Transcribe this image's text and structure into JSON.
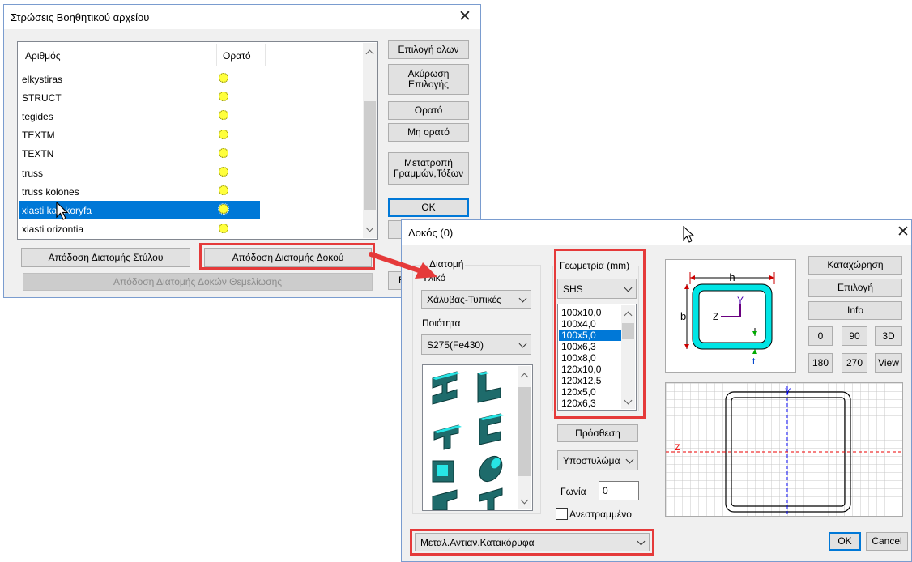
{
  "layers_dialog": {
    "title": "Στρώσεις Βοηθητικού αρχείου",
    "columns": [
      "Αριθμός",
      "Ορατό"
    ],
    "rows": [
      {
        "name": "elkystiras",
        "visible": true,
        "selected": false
      },
      {
        "name": "STRUCT",
        "visible": true,
        "selected": false
      },
      {
        "name": "tegides",
        "visible": true,
        "selected": false
      },
      {
        "name": "TEXTM",
        "visible": true,
        "selected": false
      },
      {
        "name": "TEXTN",
        "visible": true,
        "selected": false
      },
      {
        "name": "truss",
        "visible": true,
        "selected": false
      },
      {
        "name": "truss kolones",
        "visible": true,
        "selected": false
      },
      {
        "name": "xiasti katakoryfa",
        "visible": true,
        "selected": true
      },
      {
        "name": "xiasti orizontia",
        "visible": true,
        "selected": false
      }
    ],
    "buttons": {
      "select_all": "Επιλογή ολων",
      "cancel_selection": "Ακύρωση Επιλογής",
      "visible": "Ορατό",
      "not_visible": "Μη ορατό",
      "convert": "Μετατροπή Γραμμών,Τόξων",
      "ok": "OK",
      "column_section": "Απόδοση Διατομής Στύλου",
      "beam_section": "Απόδοση Διατομής Δοκού",
      "foundation_section": "Απόδοση Διατομής Δοκών Θεμελίωσης",
      "hidden_partial": "Ε"
    }
  },
  "beam_dialog": {
    "title": "Δοκός (0)",
    "section_group_label": "Διατομή",
    "material_label": "Υλικό",
    "material_value": "Χάλυβας-Τυπικές",
    "quality_label": "Ποιότητα",
    "quality_value": "S275(Fe430)",
    "geometry_label": "Γεωμετρία (mm)",
    "profile_type": "SHS",
    "sizes": [
      "100x10,0",
      "100x4,0",
      "100x5,0",
      "100x6,3",
      "100x8,0",
      "120x10,0",
      "120x12,5",
      "120x5,0",
      "120x6,3"
    ],
    "selected_size": "100x5,0",
    "add_button": "Πρόσθεση",
    "subcolumn_value": "Υποστυλώμα",
    "angle_label": "Γωνία",
    "angle_value": "0",
    "inverted_label": "Ανεστραμμένο",
    "inverted_checked": false,
    "category_value": "Μεταλ.Αντιαν.Κατακόρυφα",
    "buttons": {
      "register": "Καταχώρηση",
      "select": "Επιλογή",
      "info": "Info",
      "rot0": "0",
      "rot90": "90",
      "view3d": "3D",
      "rot180": "180",
      "rot270": "270",
      "view": "View",
      "ok": "OK",
      "cancel": "Cancel"
    },
    "diagram": {
      "h": "h",
      "b": "b",
      "y": "Y",
      "z": "Z",
      "t": "t"
    },
    "grid_axes": {
      "y": "Y",
      "z": "Z"
    }
  },
  "colors": {
    "highlight": "#e53a3a",
    "accent": "#0078d7",
    "section_fill": "#00e5e5"
  }
}
